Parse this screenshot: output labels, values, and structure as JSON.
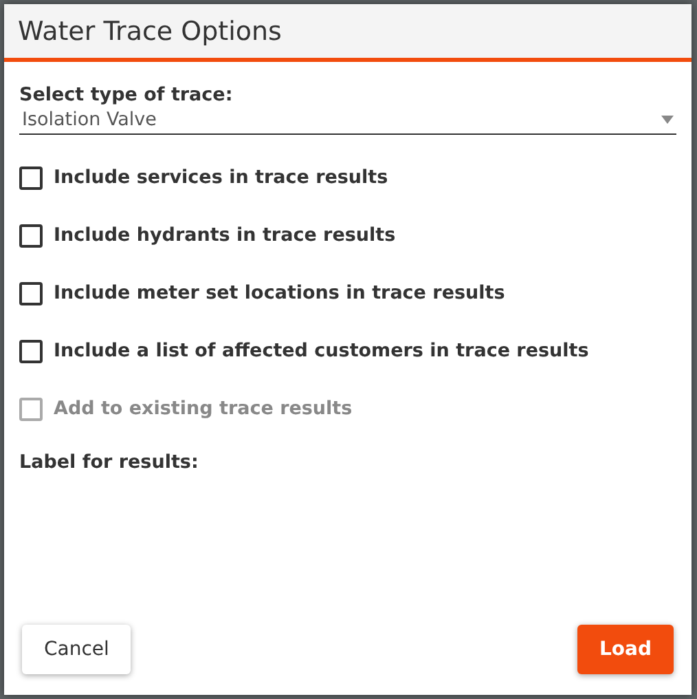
{
  "dialog": {
    "title": "Water Trace Options"
  },
  "trace_type": {
    "label": "Select type of trace:",
    "value": "Isolation Valve"
  },
  "options": [
    {
      "label": "Include services in trace results",
      "checked": false,
      "disabled": false
    },
    {
      "label": "Include hydrants in trace results",
      "checked": false,
      "disabled": false
    },
    {
      "label": "Include meter set locations in trace results",
      "checked": false,
      "disabled": false
    },
    {
      "label": "Include a list of affected customers in trace results",
      "checked": false,
      "disabled": false
    },
    {
      "label": "Add to existing trace results",
      "checked": false,
      "disabled": true
    }
  ],
  "results_label": {
    "label": "Label for results:"
  },
  "buttons": [
    {
      "label": "Cancel",
      "kind": "secondary"
    },
    {
      "label": "Load",
      "kind": "primary"
    }
  ]
}
